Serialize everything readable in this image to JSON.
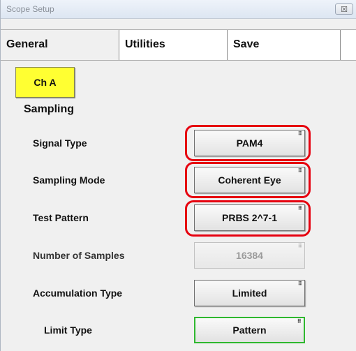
{
  "window": {
    "title": "Scope Setup",
    "close_glyph": "☒",
    "close_icon": "close-icon"
  },
  "tabs": [
    {
      "label": "General",
      "active": true
    },
    {
      "label": "Utilities",
      "active": false
    },
    {
      "label": "Save",
      "active": false
    }
  ],
  "channel": {
    "label": "Ch A",
    "color": "#ffff32"
  },
  "section": {
    "label": "Sampling"
  },
  "settings": [
    {
      "label": "Signal Type",
      "value": "PAM4",
      "enabled": true,
      "highlighted": true
    },
    {
      "label": "Sampling Mode",
      "value": "Coherent Eye",
      "enabled": true,
      "highlighted": true
    },
    {
      "label": "Test Pattern",
      "value": "PRBS 2^7-1",
      "enabled": true,
      "highlighted": true
    },
    {
      "label": "Number of Samples",
      "value": "16384",
      "enabled": false,
      "highlighted": false
    },
    {
      "label": "Accumulation Type",
      "value": "Limited",
      "enabled": true,
      "highlighted": false
    },
    {
      "label": "Limit Type",
      "value": "Pattern",
      "enabled": true,
      "highlighted": false,
      "border_color": "#2fb82f"
    }
  ],
  "colors": {
    "highlight": "#e6000f",
    "active_tab": "#f0f0f0",
    "panel": "#f0f0f0"
  }
}
